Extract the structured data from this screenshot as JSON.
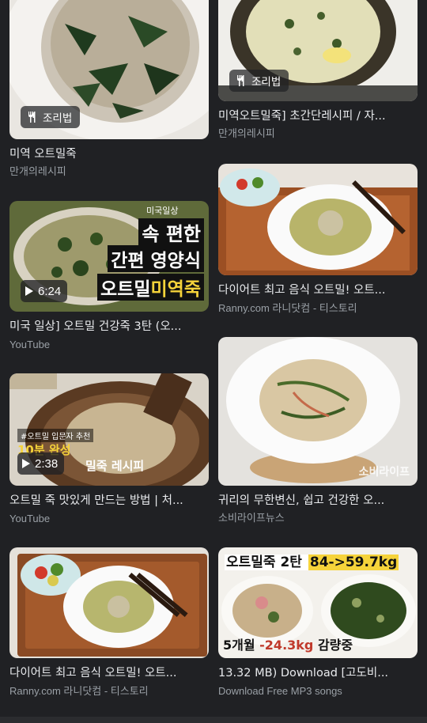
{
  "results": {
    "left": [
      {
        "title": "미역 오트밀죽",
        "source": "만개의레시피",
        "badge": "조리법"
      },
      {
        "title": "미국 일상] 오트밀 건강죽 3탄 (오...",
        "source": "YouTube",
        "duration": "6:24",
        "overlay": {
          "flag": "미국일상",
          "line1": "속 편한",
          "line2": "간편 영양식",
          "line3a": "오트밀",
          "line3b": "미역죽"
        }
      },
      {
        "title": "오트밀 죽 맛있게 만드는 방법 | 처...",
        "source": "YouTube",
        "duration": "2:38",
        "overlay": {
          "tag": "#오트밀 입문자 추천",
          "line1": "10분 완성",
          "line2": "밀죽 레시피"
        }
      },
      {
        "title": "다이어트 최고 음식 오트밀! 오트...",
        "source": "Ranny.com 라니닷컴 - 티스토리"
      }
    ],
    "right": [
      {
        "title": "미역오트밀죽] 초간단레시피 / 자...",
        "source": "만개의레시피",
        "badge": "조리법"
      },
      {
        "title": "다이어트 최고 음식 오트밀! 오트...",
        "source": "Ranny.com 라니닷컴 - 티스토리"
      },
      {
        "title": "귀리의 무한변신, 쉽고 건강한 오...",
        "source": "소비라이프뉴스",
        "watermark": "소비라이프"
      },
      {
        "title": "13.32 MB) Download [고도비...",
        "source": "Download Free MP3 songs",
        "overlay": {
          "headline_a": "오트밀죽 2탄 ",
          "headline_b": "84->59.7kg",
          "footer_a": "5개월 ",
          "footer_b": "-24.3kg",
          "footer_c": " 감량중"
        }
      }
    ]
  },
  "colors": {
    "background": "#202124",
    "title": "#e8eaed",
    "source": "#9aa0a6"
  }
}
